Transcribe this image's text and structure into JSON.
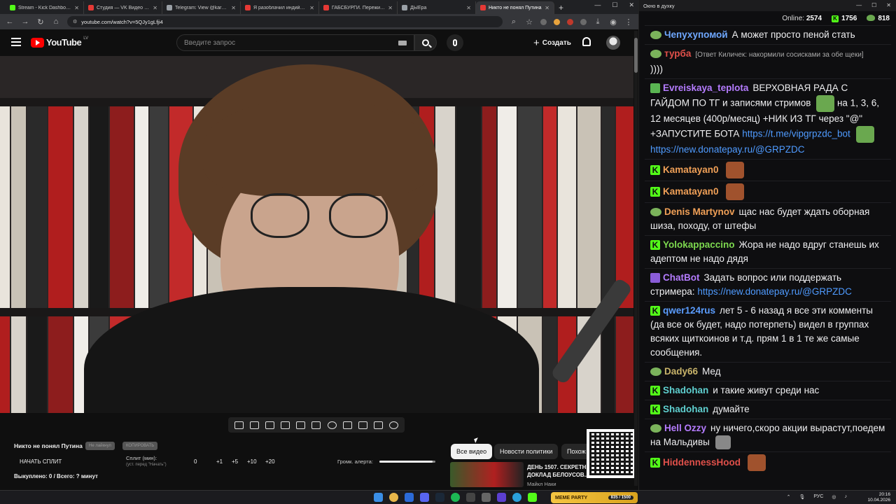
{
  "browser": {
    "tabs": [
      {
        "label": "Stream - Kick Dashboard",
        "color": "#53fc18",
        "active": false
      },
      {
        "label": "Студия — VK Видео Live",
        "color": "#e53935",
        "active": false
      },
      {
        "label": "Telegram: View @karga4",
        "color": "#9aa0a6",
        "active": false
      },
      {
        "label": "Я разоблачил индийское ...",
        "color": "#e53935",
        "active": false
      },
      {
        "label": "ГАБСБУРГИ. Пережить инце...",
        "color": "#e53935",
        "active": false
      },
      {
        "label": "ДЫЕра",
        "color": "#9aa0a6",
        "active": false
      },
      {
        "label": "Никто не понял Путина",
        "color": "#e53935",
        "active": true
      }
    ],
    "url": "youtube.com/watch?v=5QJy1gLfji4",
    "window_controls": [
      "—",
      "☐",
      "✕"
    ]
  },
  "youtube": {
    "logo_text": "YouTube",
    "country": "LV",
    "search_placeholder": "Введите запрос",
    "create_label": "Создать",
    "chips": [
      "Все видео",
      "Новости политики",
      "Похож"
    ],
    "recommended": {
      "title": "ДЕНЬ 1507. СЕКРЕТН...",
      "title2": "ДОКЛАД БЕЛОУСОВ...",
      "channel": "Майкл Наки"
    }
  },
  "overlay": {
    "video_title": "Никто не понял Путина",
    "pill1": "Не лайкнул",
    "pill2": "КОПИРОВАТЬ",
    "split_button": "НАЧАТЬ СПЛИТ",
    "split_label": "Сплит (мин):",
    "split_hint": "(уст. перед \"Начать\")",
    "split_values": [
      "0",
      "+1",
      "+5",
      "+10",
      "+20"
    ],
    "alert_label": "Громк. алерта:",
    "alert_level": 0.95,
    "bought": "Выкуплено: 0 / Всего: ? минут"
  },
  "chat": {
    "window_title": "Окно в духку",
    "online_label": "Online:",
    "online_count": "2574",
    "kick_count": "1756",
    "other_count": "818",
    "messages": [
      {
        "badge": "pepe",
        "user": "Чепухупомой",
        "color": "#6fa8ff",
        "text": "А может просто пеной стать"
      },
      {
        "badge": "pepe",
        "user": "турба",
        "color": "#e0504a",
        "reply": "[Ответ Киличек: накормили сосисками за обе щеки]",
        "text": "))))"
      },
      {
        "badge": "verified",
        "user": "Evreiskaya_teplota",
        "color": "#b57cff",
        "text": "ВЕРХОВНАЯ РАДА С ГАЙДОМ ПО ТГ и записями стримов",
        "text2": "на 1, 3, 6, 12 месяцев (400р/месяц) +НИК ИЗ ТГ через \"@\" +ЗАПУСТИТЕ БОТА",
        "link1": "https://t.me/vipgrpzdc_bot",
        "link2": "https://new.donatepay.ru/@GRPZDC"
      },
      {
        "badge": "kick",
        "user": "Kamatayan0",
        "color": "#f0a057",
        "text": ""
      },
      {
        "badge": "kick",
        "user": "Kamatayan0",
        "color": "#f0a057",
        "text": ""
      },
      {
        "badge": "pepe",
        "user": "Denis Martynov",
        "color": "#f0a057",
        "text": "щас нас будет ждать оборная шиза, походу, от штефы"
      },
      {
        "badge": "kick",
        "user": "Yolokappaccino",
        "color": "#7dd94f",
        "text": "Жора не надо вдруг станешь их адептом не надо дядя"
      },
      {
        "badge": "alien",
        "user": "ChatBot",
        "color": "#b57cff",
        "text": "Задать вопрос или поддержать стримера:",
        "link1": "https://new.donatepay.ru/@GRPZDC"
      },
      {
        "badge": "kick",
        "user": "qwer124rus",
        "color": "#5b9dff",
        "text": "лет 5 - 6 назад я все эти комменты (да все ок будет, надо потерпеть) видел в группах всяких щиткоинов и т.д. прям 1 в 1 те же самые сообщения."
      },
      {
        "badge": "pepe",
        "user": "Dady66",
        "color": "#c9b46a",
        "text": "Мед"
      },
      {
        "badge": "kick",
        "user": "Shadohan",
        "color": "#5fd0d0",
        "text": "и такие живут среди нас"
      },
      {
        "badge": "kick",
        "user": "Shadohan",
        "color": "#5fd0d0",
        "text": "думайте"
      },
      {
        "badge": "pepe",
        "user": "Hell Ozzy",
        "color": "#b57cff",
        "text": "ну ничего,скоро акции вырастут,поедем на Мальдивы"
      },
      {
        "badge": "kick",
        "user": "HiddennessHood",
        "color": "#e0504a",
        "text": ""
      }
    ]
  },
  "taskbar": {
    "meme_label": "MEME PARTY",
    "meme_count": "835 / 1500",
    "lang": "РУС",
    "time": "20:16",
    "date": "10.04.2026"
  }
}
